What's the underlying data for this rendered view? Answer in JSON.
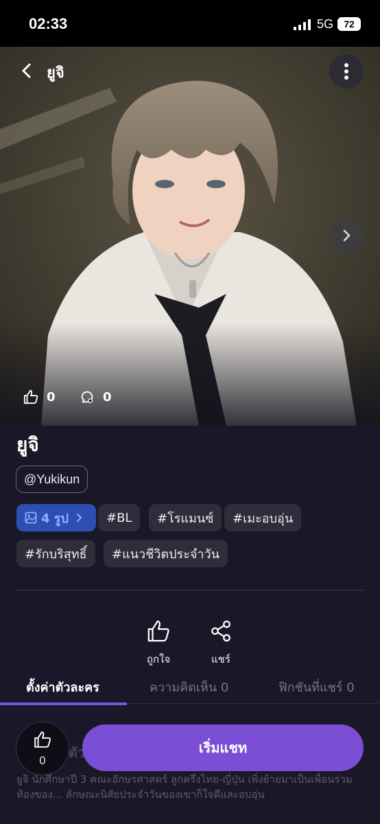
{
  "status_bar": {
    "time": "02:33",
    "network": "5G",
    "battery": "72"
  },
  "header": {
    "title": "ยูจิ"
  },
  "hero": {
    "likes": "0",
    "comments": "0"
  },
  "profile": {
    "name": "ยูจิ",
    "handle": "@Yukikun",
    "photos_label": "4 รูป",
    "tags": [
      "#BL",
      "#โรแมนซ์",
      "#เมะอบอุ่น",
      "#รักบริสุทธิ์",
      "#แนวชีวิตประจำวัน"
    ]
  },
  "actions": {
    "like_label": "ถูกใจ",
    "share_label": "แชร์"
  },
  "tabs": [
    {
      "label": "ตั้งค่าตัวละคร"
    },
    {
      "label": "ความคิดเห็น 0"
    },
    {
      "label": "ฟิกชันที่แชร์ 0"
    }
  ],
  "description": {
    "title": "ตัว",
    "text": "ยูจิ นักศึกษาปี 3 คณะอักษรศาสตร์ ลูกครึ่งไทย-ญี่ปุ่น เพิ่งย้ายมาเป็นเพื่อนร่วมห้องของ... ลักษณะนิสัยประจำวันของเขาก็ใจดีและอบอุ่น"
  },
  "bottom": {
    "like_count": "0",
    "start_chat_label": "เริ่มแชท"
  },
  "colors": {
    "accent": "#7a4fd6",
    "photo_tag_bg": "#2d4fb3",
    "background": "#1a1828"
  },
  "icons": [
    "back-chevron-icon",
    "more-vertical-icon",
    "chevron-right-icon",
    "thumbs-up-icon",
    "comment-icon",
    "image-icon",
    "share-icon"
  ]
}
